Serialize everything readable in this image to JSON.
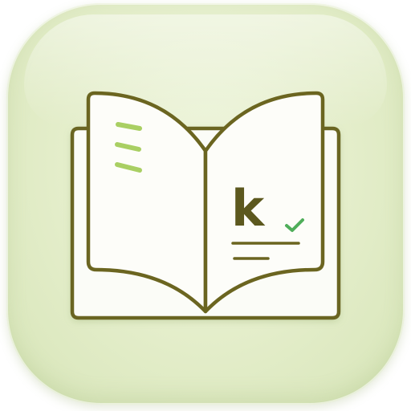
{
  "icon": {
    "name": "open-book-dictionary-icon",
    "letter": "k",
    "colors": {
      "tile_background": "#e3edc9",
      "book_outline": "#6b6520",
      "page_fill": "#fbfcf7",
      "accent_lines": "#a9cf63",
      "checkmark": "#4fae5a"
    }
  }
}
